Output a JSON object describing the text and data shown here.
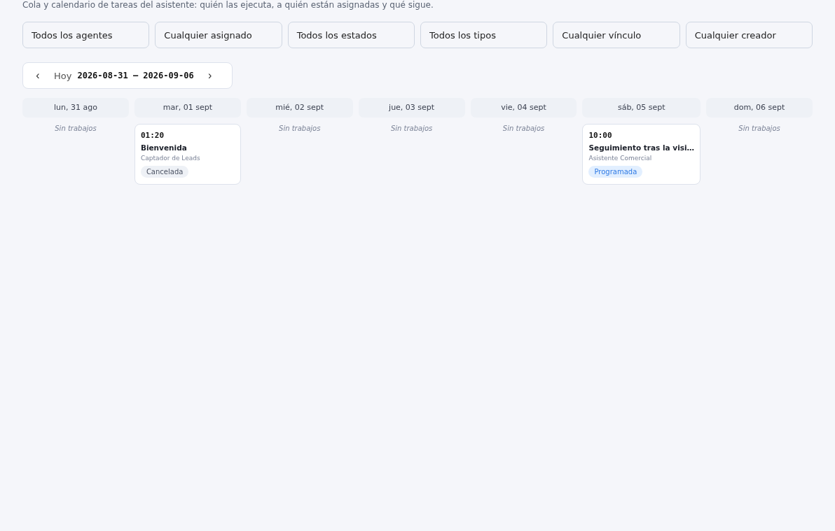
{
  "description": "Cola y calendario de tareas del asistente: quién las ejecuta, a quién están asignadas y qué sigue.",
  "filters": [
    {
      "label": "Todos los agentes"
    },
    {
      "label": "Cualquier asignado"
    },
    {
      "label": "Todos los estados"
    },
    {
      "label": "Todos los tipos"
    },
    {
      "label": "Cualquier vínculo"
    },
    {
      "label": "Cualquier creador"
    }
  ],
  "week_nav": {
    "prev": "‹",
    "today": "Hoy",
    "range": "2026-08-31 – 2026-09-06",
    "next": "›"
  },
  "days": [
    {
      "label": "lun, 31 ago",
      "empty_text": "Sin trabajos"
    },
    {
      "label": "mar, 01 sept",
      "jobs": [
        {
          "time": "01:20",
          "title": "Bienvenida",
          "agent": "Captador de Leads",
          "status": "Cancelada",
          "kind": "cancelled"
        }
      ]
    },
    {
      "label": "mié, 02 sept",
      "empty_text": "Sin trabajos"
    },
    {
      "label": "jue, 03 sept",
      "empty_text": "Sin trabajos"
    },
    {
      "label": "vie, 04 sept",
      "empty_text": "Sin trabajos"
    },
    {
      "label": "sáb, 05 sept",
      "jobs": [
        {
          "time": "10:00",
          "title": "Seguimiento tras la visi…",
          "agent": "Asistente Comercial",
          "status": "Programada",
          "kind": "scheduled"
        }
      ]
    },
    {
      "label": "dom, 06 sept",
      "empty_text": "Sin trabajos"
    }
  ]
}
